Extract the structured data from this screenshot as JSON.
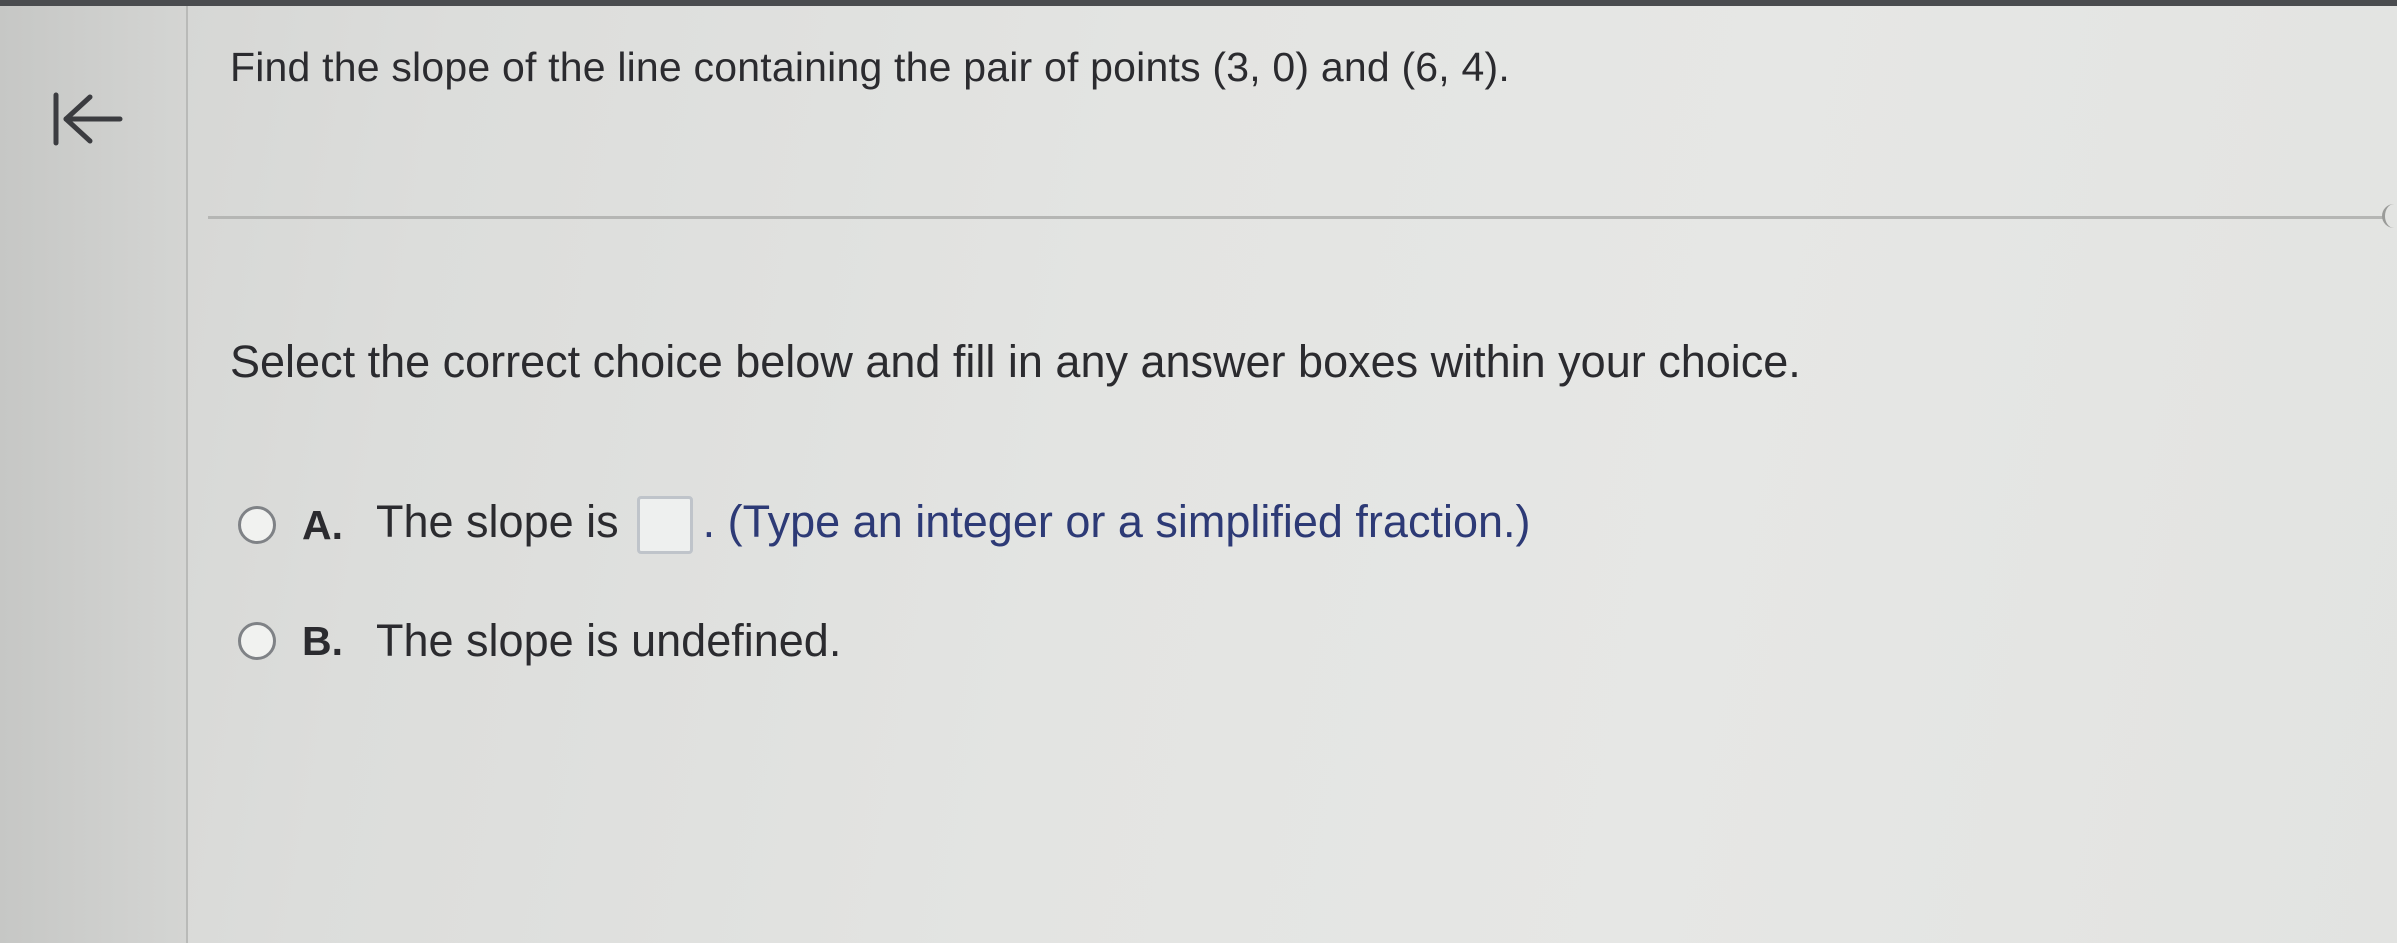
{
  "question": {
    "text": "Find the slope of the line containing the pair of points (3, 0) and (6, 4)."
  },
  "instructions": "Select the correct choice below and fill in any answer boxes within your choice.",
  "choices": [
    {
      "letter": "A.",
      "text_before": "The slope is",
      "answer_value": "",
      "text_after": ". (Type an integer or a simplified fraction.)",
      "selected": false
    },
    {
      "letter": "B.",
      "text": "The slope is undefined.",
      "selected": false
    }
  ],
  "icons": {
    "back": "first-page-arrow-icon",
    "radio": "radio-unselected"
  },
  "colors": {
    "text": "#2b2b2f",
    "hint_text": "#2d3a76",
    "radio_border": "#7f8286"
  }
}
